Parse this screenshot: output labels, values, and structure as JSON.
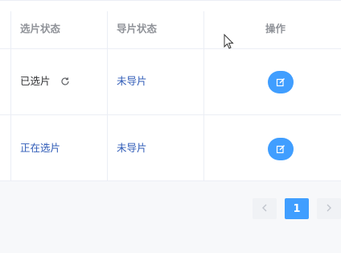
{
  "table": {
    "headers": {
      "selection_status": "选片状态",
      "guide_status": "导片状态",
      "actions": "操作"
    },
    "rows": [
      {
        "selection_status": "已选片",
        "guide_status": "未导片"
      },
      {
        "selection_status": "正在选片",
        "guide_status": "未导片"
      }
    ]
  },
  "pagination": {
    "prev_icon": "chevron-left-icon",
    "current_page": "1",
    "next_icon": "chevron-right-icon"
  },
  "colors": {
    "primary": "#409eff",
    "link": "#2f5bb7",
    "header_text": "#909399",
    "border": "#ebeef5"
  }
}
